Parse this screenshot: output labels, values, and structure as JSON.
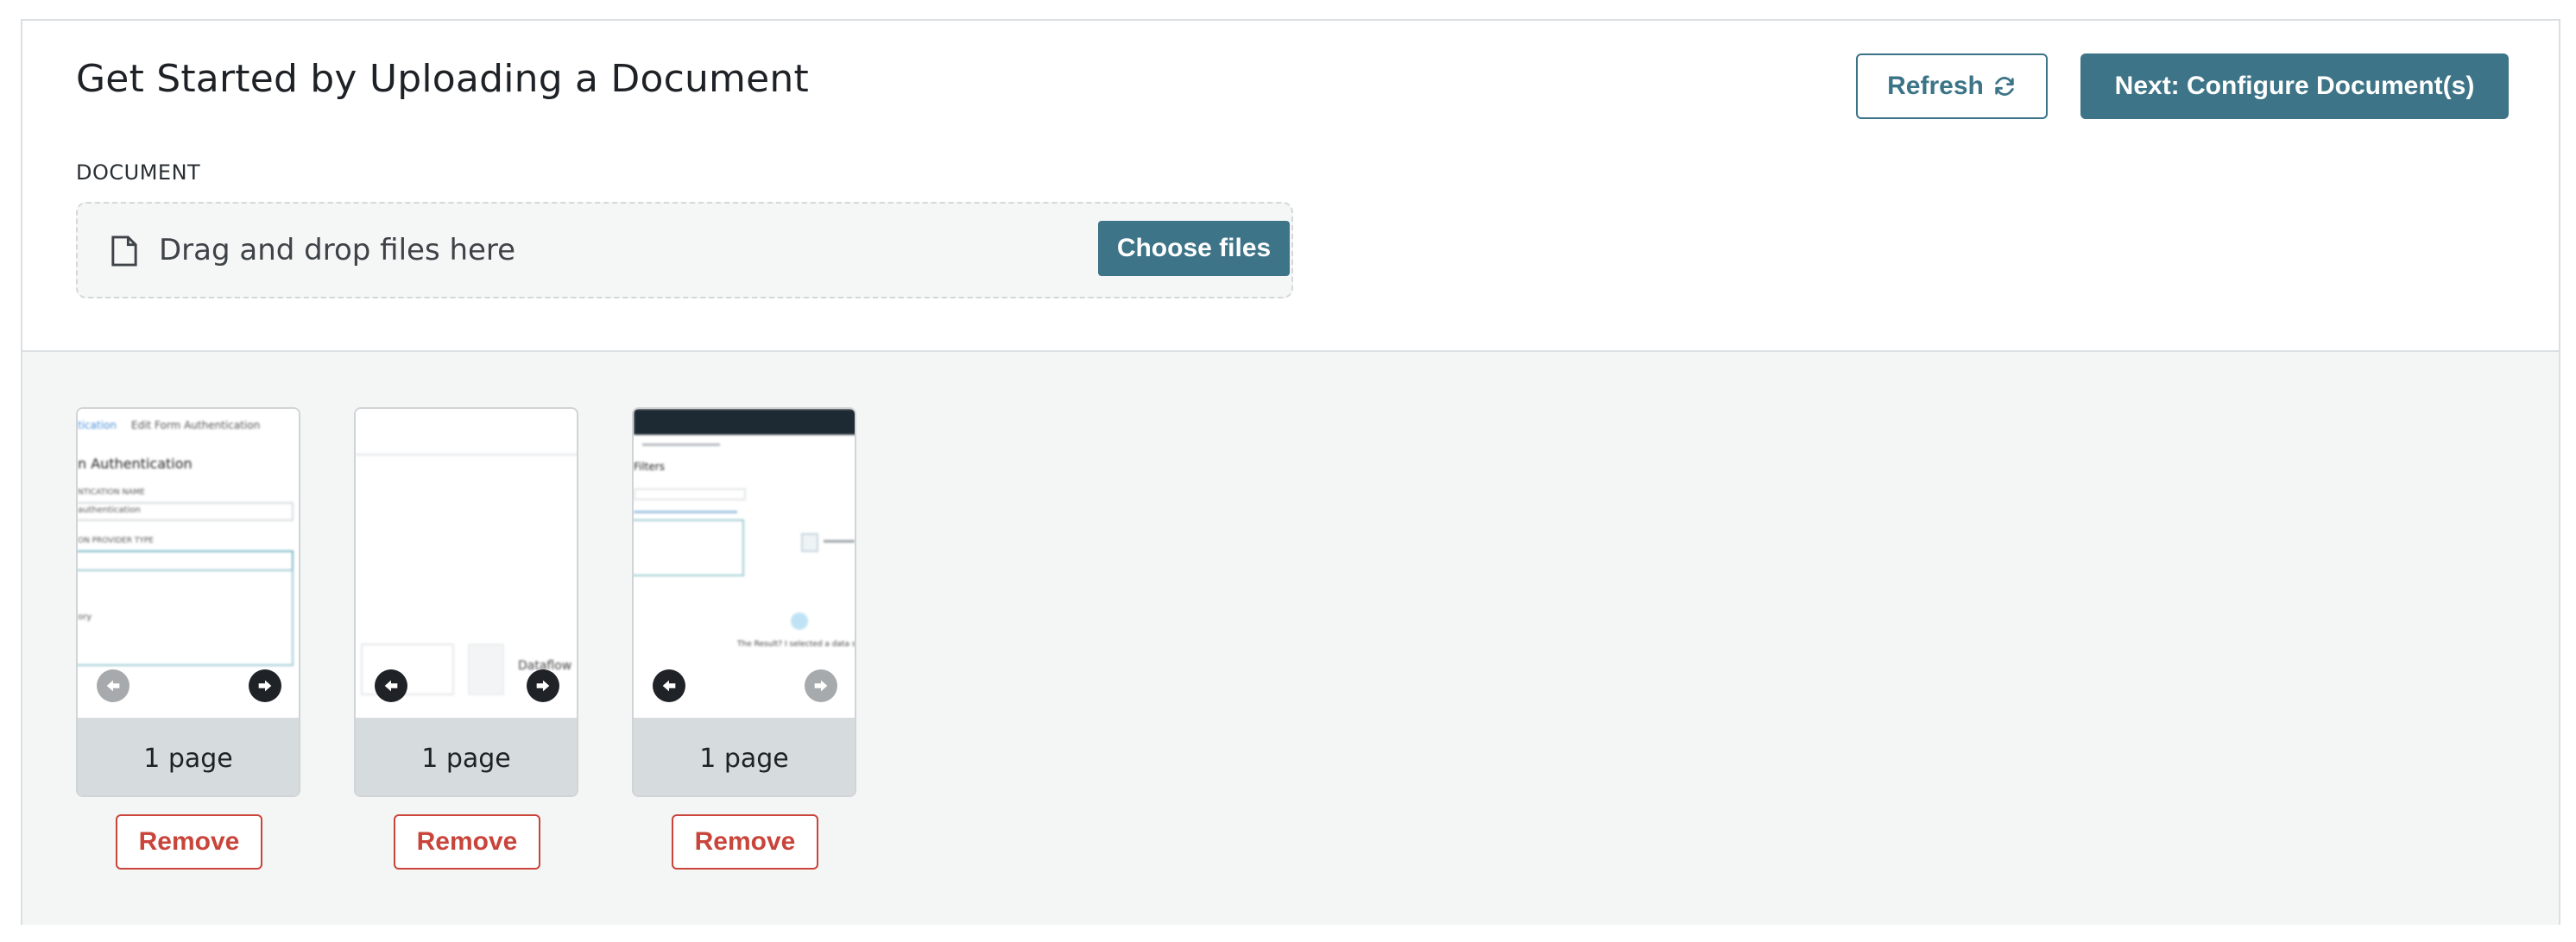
{
  "header": {
    "title": "Get Started by Uploading a Document",
    "refresh_label": "Refresh",
    "next_label": "Next: Configure Document(s)"
  },
  "upload": {
    "section_label": "DOCUMENT",
    "dropzone_text": "Drag and drop files here",
    "choose_label": "Choose files"
  },
  "files": [
    {
      "page_count": "1 page",
      "remove_label": "Remove",
      "thumb": {
        "breadcrumb_link": "tication",
        "breadcrumb_current": "Edit Form Authentication",
        "heading": "n Authentication",
        "field1_label": "NTICATION NAME",
        "field1_value": "authentication",
        "field2_label": "ON PROVIDER TYPE",
        "option": "ory"
      }
    },
    {
      "page_count": "1 page",
      "remove_label": "Remove",
      "thumb": {
        "caption": "Dataflow"
      }
    },
    {
      "page_count": "1 page",
      "remove_label": "Remove",
      "thumb": {
        "heading": "Filters",
        "message": "The Result? I selected a data source"
      }
    }
  ],
  "colors": {
    "primary": "#3d7487",
    "danger": "#c9443a",
    "panel": "#f4f5f5"
  }
}
